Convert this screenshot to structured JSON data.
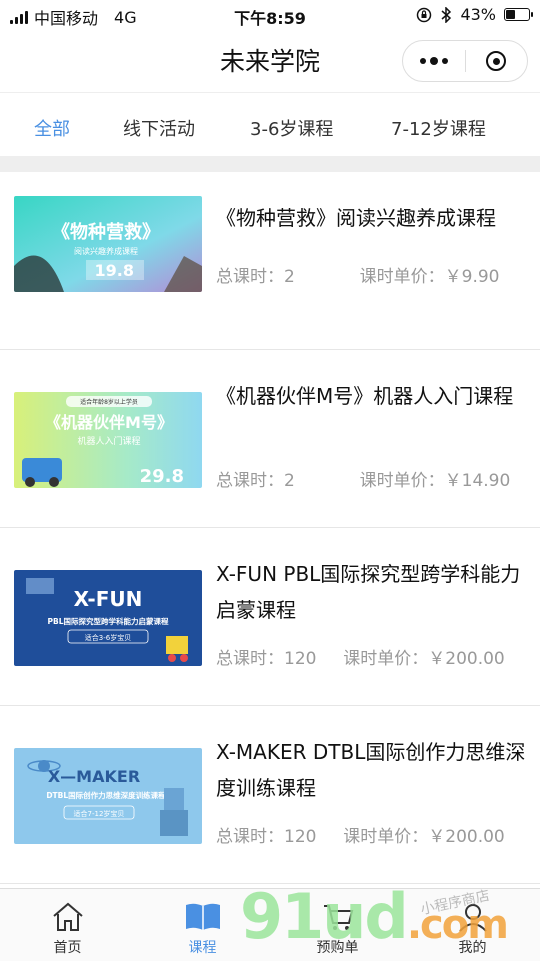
{
  "status_bar": {
    "carrier": "中国移动",
    "network": "4G",
    "time": "下午8:59",
    "battery": "43%",
    "battery_level": 0.43
  },
  "navbar": {
    "title": "未来学院"
  },
  "tabs": [
    {
      "label": "全部",
      "active": true
    },
    {
      "label": "线下活动",
      "active": false
    },
    {
      "label": "3-6岁课程",
      "active": false
    },
    {
      "label": "7-12岁课程",
      "active": false
    }
  ],
  "courses": [
    {
      "name": "《物种营救》阅读兴趣养成课程",
      "hours_label": "总课时：2",
      "price_label": "课时单价：￥9.90",
      "thumb": {
        "title": "《物种营救》",
        "subtitle": "阅读兴趣养成课程",
        "price": "19.8"
      }
    },
    {
      "name": "《机器伙伴M号》机器人入门课程",
      "hours_label": "总课时：2",
      "price_label": "课时单价：￥14.90",
      "thumb": {
        "tag": "适合年龄8岁以上学员",
        "title": "《机器伙伴M号》",
        "subtitle": "机器人入门课程",
        "price": "29.8"
      }
    },
    {
      "name": "X-FUN PBL国际探究型跨学科能力启蒙课程",
      "hours_label": "总课时：120",
      "price_label": "课时单价：￥200.00",
      "thumb": {
        "title": "X-FUN",
        "subtitle": "PBL国际探究型跨学科能力启蒙课程",
        "tag": "适合3-6岁宝贝"
      }
    },
    {
      "name": "X-MAKER DTBL国际创作力思维深度训练课程",
      "hours_label": "总课时：120",
      "price_label": "课时单价：￥200.00",
      "thumb": {
        "title": "X—MAKER",
        "subtitle": "DTBL国际创作力思维深度训练课程",
        "tag": "适合7-12岁宝贝"
      }
    }
  ],
  "tabbar": [
    {
      "label": "首页",
      "icon": "home-icon",
      "active": false
    },
    {
      "label": "课程",
      "icon": "book-icon",
      "active": true
    },
    {
      "label": "预购单",
      "icon": "cart-icon",
      "active": false
    },
    {
      "label": "我的",
      "icon": "user-icon",
      "active": false
    }
  ],
  "watermark": {
    "text": "91ud",
    "suffix": ".com",
    "script": "小程序商店"
  },
  "colors": {
    "accent": "#4a90e2"
  }
}
